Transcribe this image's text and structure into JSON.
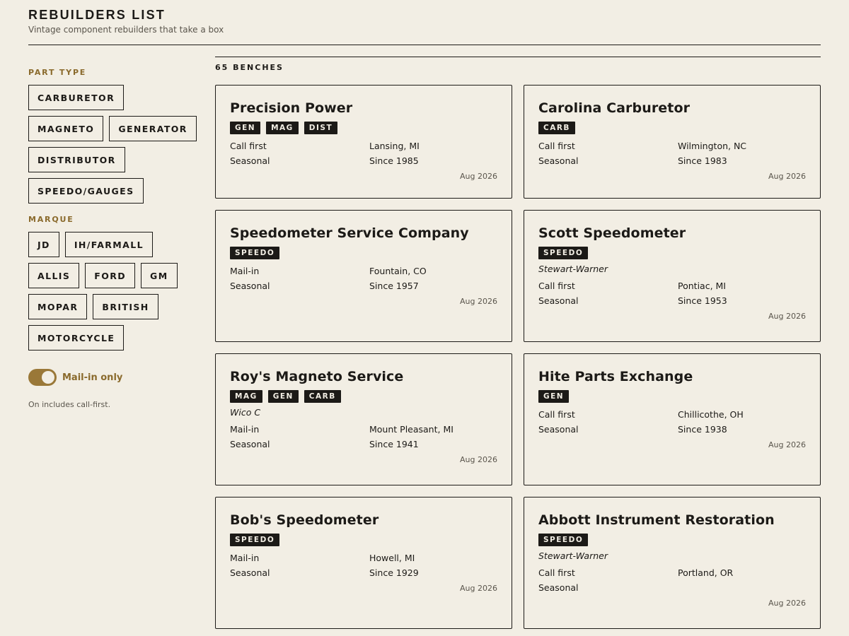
{
  "header": {
    "title": "REBUILDERS LIST",
    "subtitle": "Vintage component rebuilders that take a box"
  },
  "filters": {
    "part_type_label": "PART TYPE",
    "part_types": [
      "CARBURETOR",
      "MAGNETO",
      "GENERATOR",
      "DISTRIBUTOR",
      "SPEEDO/GAUGES"
    ],
    "marque_label": "MARQUE",
    "marques": [
      "JD",
      "IH/FARMALL",
      "ALLIS",
      "FORD",
      "GM",
      "MOPAR",
      "BRITISH",
      "MOTORCYCLE"
    ],
    "toggle_label": "Mail-in only",
    "toggle_on": true,
    "toggle_note": "On includes call-first."
  },
  "results": {
    "count": "65 BENCHES",
    "cards": [
      {
        "name": "Precision Power",
        "tags": [
          "GEN",
          "MAG",
          "DIST"
        ],
        "maker": "",
        "method": "Call first",
        "location": "Lansing, MI",
        "availability": "Seasonal",
        "since": "Since 1985",
        "date": "Aug 2026"
      },
      {
        "name": "Carolina Carburetor",
        "tags": [
          "CARB"
        ],
        "maker": "",
        "method": "Call first",
        "location": "Wilmington, NC",
        "availability": "Seasonal",
        "since": "Since 1983",
        "date": "Aug 2026"
      },
      {
        "name": "Speedometer Service Company",
        "tags": [
          "SPEEDO"
        ],
        "maker": "",
        "method": "Mail-in",
        "location": "Fountain, CO",
        "availability": "Seasonal",
        "since": "Since 1957",
        "date": "Aug 2026"
      },
      {
        "name": "Scott Speedometer",
        "tags": [
          "SPEEDO"
        ],
        "maker": "Stewart-Warner",
        "method": "Call first",
        "location": "Pontiac, MI",
        "availability": "Seasonal",
        "since": "Since 1953",
        "date": "Aug 2026"
      },
      {
        "name": "Roy's Magneto Service",
        "tags": [
          "MAG",
          "GEN",
          "CARB"
        ],
        "maker": "Wico C",
        "method": "Mail-in",
        "location": "Mount Pleasant, MI",
        "availability": "Seasonal",
        "since": "Since 1941",
        "date": "Aug 2026"
      },
      {
        "name": "Hite Parts Exchange",
        "tags": [
          "GEN"
        ],
        "maker": "",
        "method": "Call first",
        "location": "Chillicothe, OH",
        "availability": "Seasonal",
        "since": "Since 1938",
        "date": "Aug 2026"
      },
      {
        "name": "Bob's Speedometer",
        "tags": [
          "SPEEDO"
        ],
        "maker": "",
        "method": "Mail-in",
        "location": "Howell, MI",
        "availability": "Seasonal",
        "since": "Since 1929",
        "date": "Aug 2026"
      },
      {
        "name": "Abbott Instrument Restoration",
        "tags": [
          "SPEEDO"
        ],
        "maker": "Stewart-Warner",
        "method": "Call first",
        "location": "Portland, OR",
        "availability": "Seasonal",
        "since": "",
        "date": "Aug 2026"
      }
    ]
  },
  "colors": {
    "background": "#f2eee4",
    "ink": "#1c1a17",
    "accent": "#8a6a2c",
    "toggle": "#9a7838"
  }
}
